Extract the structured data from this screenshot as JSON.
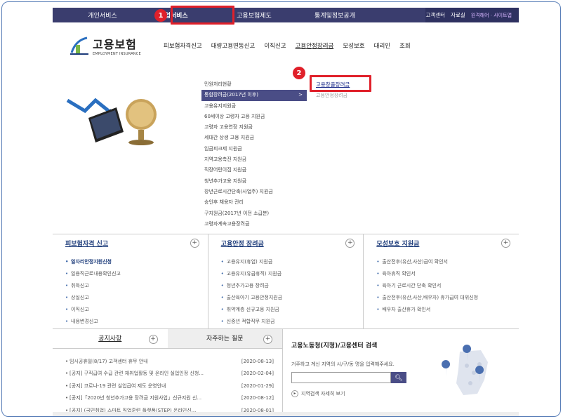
{
  "topbar": {
    "items": [
      "개인서비스",
      "기업서비스",
      "고용보험제도",
      "통계및정보공개"
    ],
    "right": [
      "고객센터",
      "자료실"
    ],
    "right_small": "원격해어 · 사이트맵"
  },
  "badges": [
    "1",
    "2"
  ],
  "logo": {
    "name": "고용보험",
    "en": "EMPLOYMENT INSURANCE"
  },
  "main_nav": [
    "피보험자격신고",
    "대량고용변동신고",
    "이직신고",
    "고용안정장려금",
    "모성보호",
    "대리인",
    "조회"
  ],
  "submenu": [
    "민원처리현황",
    "통합장려금(2017년 이후)",
    "고용유지지원금",
    "60세이상 고령자 고용 지원금",
    "고령자 고용연장 지원금",
    "세대간 상생 고용 지원금",
    "임금피크제 지원금",
    "지역고용촉진 지원금",
    "직장어린이집 지원금",
    "청년추가고용 지원금",
    "장년근로시간단축(사업주) 지원금",
    "승인후 채용자 관리",
    "구지원금(2017년 이전 소급분)",
    "고령자계속고용장려금"
  ],
  "submenu2": {
    "link": "고용창출장려금",
    "faint": "고용안정장려금"
  },
  "panels": [
    {
      "title": "피보험자격 신고",
      "items": [
        "일자리안정지원신청",
        "일용직근로내용확인신고",
        "취득신고",
        "상실신고",
        "이직신고",
        "내용변경신고"
      ]
    },
    {
      "title": "고용안정 장려금",
      "items": [
        "고용유지(휴업) 지원금",
        "고용유지(유급휴직) 지원금",
        "청년추가고용 장려금",
        "출산육아기 고용안정지원금",
        "취약계층 신규고용 지원금",
        "신중년 적합직무 지원금"
      ]
    },
    {
      "title": "모성보호 지원금",
      "items": [
        "출산전후(유산,사산)급여 확인서",
        "육아휴직 확인서",
        "육아기 근로시간 단축 확인서",
        "출산전후(유산,사산,배우자) 휴가급여 대위신청",
        "배우자 출산휴가 확인서"
      ]
    }
  ],
  "plus": "+",
  "notice": {
    "tabs": [
      "공지사항",
      "자주하는 질문"
    ],
    "rows": [
      {
        "title": "임시공휴일(8/17) 고객센터 휴무 안내",
        "date": "[2020-08-13]"
      },
      {
        "title": "[공지] 구직급여 수급 관련 재취업활동 및 온라인 실업인정 신청...",
        "date": "[2020-02-04]"
      },
      {
        "title": "[공지] 코로나-19 관련 실업급여 제도 운영안내",
        "date": "[2020-01-29]"
      },
      {
        "title": "[공지]「2020년 청년추가고용 장려금 지원사업」신규지원 신...",
        "date": "[2020-08-12]"
      },
      {
        "title": "[공지] (국민취업) 스마트 직업훈련 플랫폼(STEP) 온라인신...",
        "date": "[2020-08-01]"
      }
    ]
  },
  "search": {
    "title": "고용노동청(지청)/고용센터 검색",
    "desc": "거주하고 계신 지역의 시/구/동 명을 입력해주세요.",
    "more": "지역검색 자세히 보기",
    "button_icon": "search-icon"
  }
}
